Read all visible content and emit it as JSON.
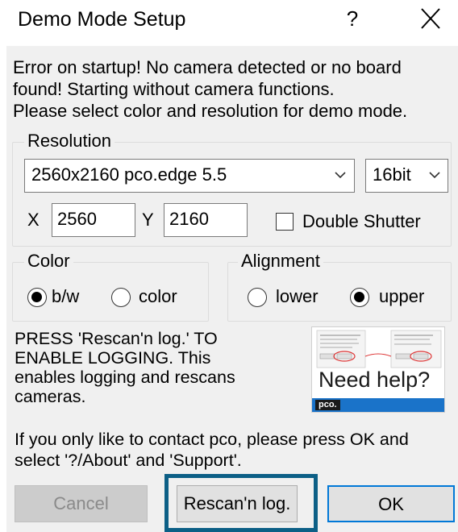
{
  "window": {
    "title": "Demo Mode Setup",
    "help_glyph": "?",
    "close_icon": "close-icon"
  },
  "message": {
    "lines": [
      "Error on startup! No camera detected or no board",
      "found! Starting without camera functions.",
      "Please select color and resolution for demo mode."
    ]
  },
  "resolution": {
    "group_label": "Resolution",
    "camera_select_value": "2560x2160 pco.edge 5.5",
    "bitdepth_select_value": "16bit",
    "x_label": "X",
    "x_value": "2560",
    "y_label": "Y",
    "y_value": "2160",
    "double_shutter_label": "Double Shutter",
    "double_shutter_checked": false
  },
  "color": {
    "group_label": "Color",
    "options": [
      {
        "label": "b/w",
        "selected": true
      },
      {
        "label": "color",
        "selected": false
      }
    ]
  },
  "alignment": {
    "group_label": "Alignment",
    "options": [
      {
        "label": "lower",
        "selected": false
      },
      {
        "label": "upper",
        "selected": true
      }
    ]
  },
  "press_info": {
    "lines": [
      "PRESS 'Rescan'n log.' TO",
      "ENABLE LOGGING. This",
      "enables logging and rescans",
      "cameras."
    ]
  },
  "help_image": {
    "caption": "Need help?",
    "brand": "pco.",
    "accent_color": "#1a73c9"
  },
  "contact_info": {
    "lines": [
      "If you only like to contact pco, please press OK and",
      "select '?/About' and 'Support'."
    ]
  },
  "buttons": {
    "cancel": "Cancel",
    "rescan": "Rescan'n log.",
    "ok": "OK"
  },
  "colors": {
    "highlight_border": "#0c5f86",
    "default_button_border": "#0078d7",
    "dialog_background": "#f0f0f0"
  }
}
